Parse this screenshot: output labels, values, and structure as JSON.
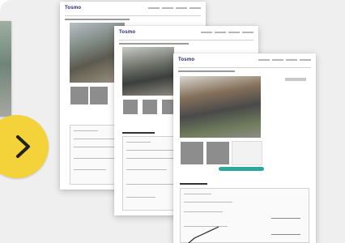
{
  "brand": {
    "logo_text": "Tosmo"
  },
  "colors": {
    "accent_yellow": "#f4d33a",
    "teal": "#2da8a0",
    "background": "#efefef"
  },
  "icons": {
    "next": "chevron-right-icon"
  }
}
